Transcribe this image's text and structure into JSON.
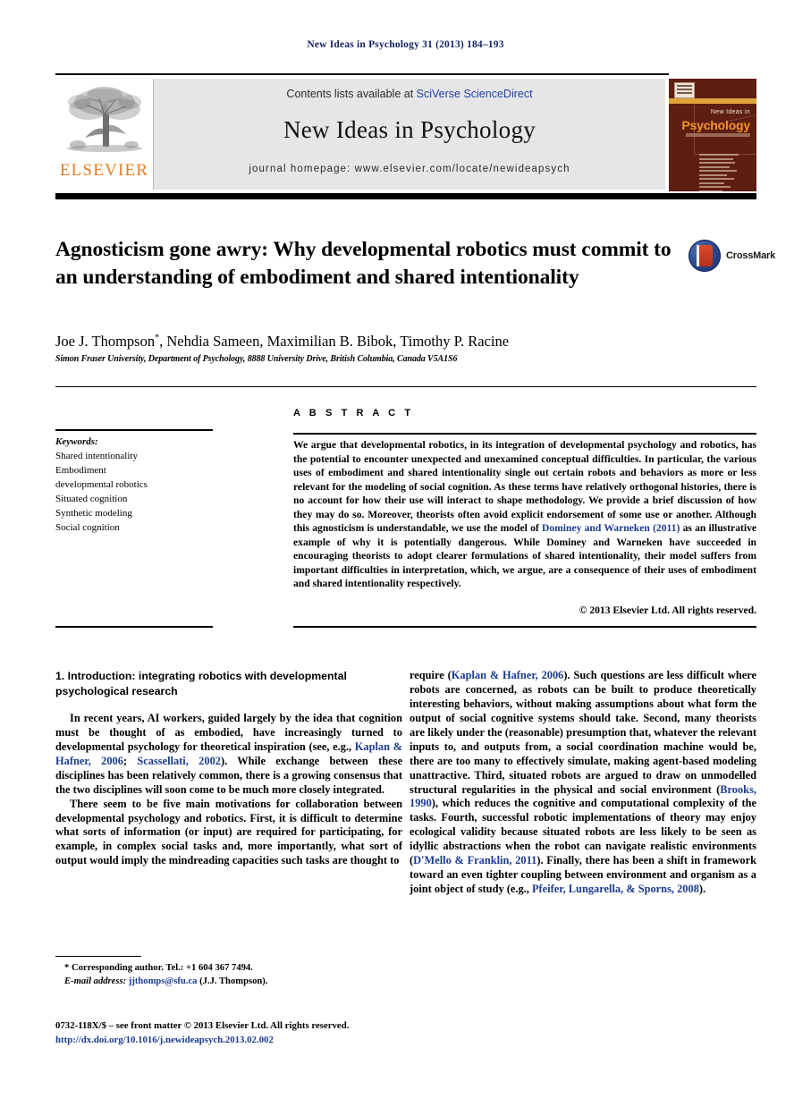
{
  "running_head": "New Ideas in Psychology 31 (2013) 184–193",
  "header": {
    "contents_prefix": "Contents lists available at ",
    "sciencedirect_link": "SciVerse ScienceDirect",
    "journal_title": "New Ideas in Psychology",
    "homepage_line": "journal homepage: www.elsevier.com/locate/newideapsych",
    "publisher_wordmark": "ELSEVIER",
    "cover": {
      "line1": "New Ideas in",
      "line2": "Psychology"
    }
  },
  "article": {
    "title": "Agnosticism gone awry: Why developmental robotics must commit to an understanding of embodiment and shared intentionality",
    "crossmark_label": "CrossMark",
    "authors": "Joe J. Thompson",
    "authors_rest": ", Nehdia Sameen, Maximilian B. Bibok, Timothy P. Racine",
    "corresponding_marker": "*",
    "affiliation": "Simon Fraser University, Department of Psychology, 8888 University Drive, British Columbia, Canada V5A1S6"
  },
  "keywords": {
    "heading": "Keywords:",
    "items": [
      "Shared intentionality",
      "Embodiment",
      "developmental robotics",
      "Situated cognition",
      "Synthetic modeling",
      "Social cognition"
    ]
  },
  "abstract": {
    "label": "A B S T R A C T",
    "part1": "We argue that developmental robotics, in its integration of developmental psychology and robotics, has the potential to encounter unexpected and unexamined conceptual difficulties. In particular, the various uses of embodiment and shared intentionality single out certain robots and behaviors as more or less relevant for the modeling of social cognition. As these terms have relatively orthogonal histories, there is no account for how their use will interact to shape methodology. We provide a brief discussion of how they may do so. Moreover, theorists often avoid explicit endorsement of some use or another. Although this agnosticism is understandable, we use the model of ",
    "citation": "Dominey and Warneken (2011)",
    "part2": " as an illustrative example of why it is potentially dangerous. While Dominey and Warneken have succeeded in encouraging theorists to adopt clearer formulations of shared intentionality, their model suffers from important difficulties in interpretation, which, we argue, are a consequence of their uses of embodiment and shared intentionality respectively.",
    "copyright": "© 2013 Elsevier Ltd. All rights reserved."
  },
  "body": {
    "section_heading": "1. Introduction: integrating robotics with developmental psychological research",
    "left_p1_a": "In recent years, AI workers, guided largely by the idea that cognition must be thought of as embodied, have increasingly turned to developmental psychology for theoretical inspiration (see, e.g., ",
    "left_p1_cite1": "Kaplan & Hafner, 2006",
    "left_p1_b": "; ",
    "left_p1_cite2": "Scassellati, 2002",
    "left_p1_c": "). While exchange between these disciplines has been relatively common, there is a growing consensus that the two disciplines will soon come to be much more closely integrated.",
    "left_p2": "There seem to be five main motivations for collaboration between developmental psychology and robotics. First, it is difficult to determine what sorts of information (or input) are required for participating, for example, in complex social tasks and, more importantly, what sort of output would imply the mindreading capacities such tasks are thought to",
    "right_a": "require (",
    "right_cite1": "Kaplan & Hafner, 2006",
    "right_b": "). Such questions are less difficult where robots are concerned, as robots can be built to produce theoretically interesting behaviors, without making assumptions about what form the output of social cognitive systems should take. Second, many theorists are likely under the (reasonable) presumption that, whatever the relevant inputs to, and outputs from, a social coordination machine would be, there are too many to effectively simulate, making agent-based modeling unattractive. Third, situated robots are argued to draw on unmodelled structural regularities in the physical and social environment (",
    "right_cite2": "Brooks, 1990",
    "right_c": "), which reduces the cognitive and computational complexity of the tasks. Fourth, successful robotic implementations of theory may enjoy ecological validity because situated robots are less likely to be seen as idyllic abstractions when the robot can navigate realistic environments (",
    "right_cite3": "D'Mello & Franklin, 2011",
    "right_d": "). Finally, there has been a shift in framework toward an even tighter coupling between environment and organism as a joint object of study (e.g., ",
    "right_cite4": "Pfeifer, Lungarella, & Sporns, 2008",
    "right_e": ")."
  },
  "footnote": {
    "corresponding": "* Corresponding author. Tel.: +1 604 367 7494.",
    "email_label": "E-mail address:",
    "email": "jjthomps@sfu.ca",
    "email_suffix": " (J.J. Thompson)."
  },
  "bottom": {
    "issn_line": "0732-118X/$ – see front matter © 2013 Elsevier Ltd. All rights reserved.",
    "doi": "http://dx.doi.org/10.1016/j.newideapsych.2013.02.002"
  },
  "colors": {
    "link": "#1b3b8f",
    "elsevier_orange": "#e87c1e",
    "cover_maroon": "#5e1f12",
    "masthead_gray": "#e6e6e6"
  }
}
